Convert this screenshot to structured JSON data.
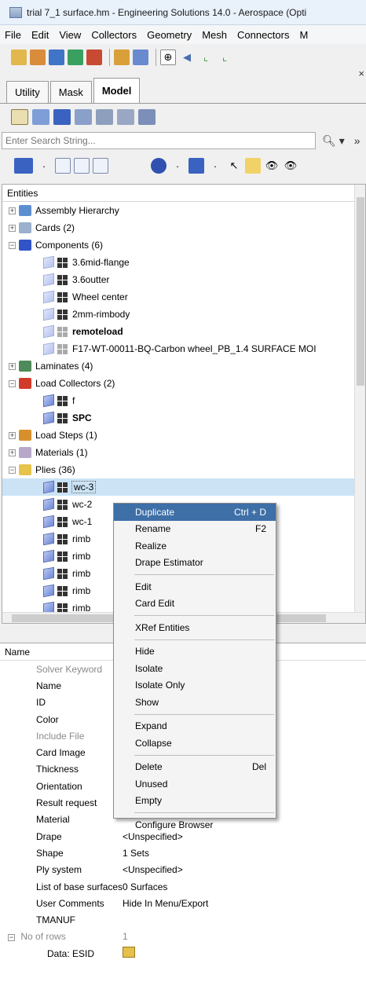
{
  "window": {
    "title": "trial 7_1 surface.hm - Engineering Solutions 14.0 - Aerospace (Opti"
  },
  "menu": [
    "File",
    "Edit",
    "View",
    "Collectors",
    "Geometry",
    "Mesh",
    "Connectors",
    "M"
  ],
  "tabs": [
    {
      "label": "Utility"
    },
    {
      "label": "Mask"
    },
    {
      "label": "Model"
    }
  ],
  "search": {
    "placeholder": "Enter Search String..."
  },
  "tree": {
    "header": "Entities",
    "rows": [
      {
        "label": "Assembly Hierarchy"
      },
      {
        "label": "Cards (2)"
      },
      {
        "label": "Components (6)"
      },
      {
        "label": "3.6mid-flange"
      },
      {
        "label": "3.6outter"
      },
      {
        "label": "Wheel center"
      },
      {
        "label": "2mm-rimbody"
      },
      {
        "label": "remoteload"
      },
      {
        "label": "F17-WT-00011-BQ-Carbon wheel_PB_1.4 SURFACE MOI"
      },
      {
        "label": "Laminates (4)"
      },
      {
        "label": "Load Collectors (2)"
      },
      {
        "label": "f"
      },
      {
        "label": "SPC"
      },
      {
        "label": "Load Steps (1)"
      },
      {
        "label": "Materials (1)"
      },
      {
        "label": "Plies (36)"
      },
      {
        "label": "wc-3"
      },
      {
        "label": "wc-2"
      },
      {
        "label": "wc-1"
      },
      {
        "label": "rimb"
      },
      {
        "label": "rimb"
      },
      {
        "label": "rimb"
      },
      {
        "label": "rimb"
      },
      {
        "label": "rimb"
      }
    ]
  },
  "properties": {
    "header": "Name",
    "rows": [
      {
        "name": "Solver Keyword",
        "value": ""
      },
      {
        "name": "Name",
        "value": ""
      },
      {
        "name": "ID",
        "value": ""
      },
      {
        "name": "Color",
        "value": ""
      },
      {
        "name": "Include File",
        "value": ""
      },
      {
        "name": "Card Image",
        "value": ""
      },
      {
        "name": "Thickness",
        "value": ""
      },
      {
        "name": "Orientation",
        "value": ""
      },
      {
        "name": "Result request",
        "value": ""
      },
      {
        "name": "Material",
        "value": ""
      },
      {
        "name": "Drape",
        "value": "<Unspecified>"
      },
      {
        "name": "Shape",
        "value": "1 Sets"
      },
      {
        "name": "Ply system",
        "value": "<Unspecified>"
      },
      {
        "name": "List of base surfaces",
        "value": "0 Surfaces"
      },
      {
        "name": "User Comments",
        "value": "Hide In Menu/Export"
      },
      {
        "name": "TMANUF",
        "value": ""
      },
      {
        "name": "No of rows",
        "value": "1"
      },
      {
        "name": "Data: ESID",
        "value": ""
      }
    ]
  },
  "context_menu": {
    "items": [
      {
        "label": "Duplicate",
        "shortcut": "Ctrl + D"
      },
      {
        "label": "Rename",
        "shortcut": "F2"
      },
      {
        "label": "Realize",
        "shortcut": ""
      },
      {
        "label": "Drape Estimator",
        "shortcut": ""
      },
      {
        "label": "Edit",
        "shortcut": ""
      },
      {
        "label": "Card Edit",
        "shortcut": ""
      },
      {
        "label": "XRef Entities",
        "shortcut": ""
      },
      {
        "label": "Hide",
        "shortcut": ""
      },
      {
        "label": "Isolate",
        "shortcut": ""
      },
      {
        "label": "Isolate Only",
        "shortcut": ""
      },
      {
        "label": "Show",
        "shortcut": ""
      },
      {
        "label": "Expand",
        "shortcut": ""
      },
      {
        "label": "Collapse",
        "shortcut": ""
      },
      {
        "label": "Delete",
        "shortcut": "Del"
      },
      {
        "label": "Unused",
        "shortcut": ""
      },
      {
        "label": "Empty",
        "shortcut": ""
      },
      {
        "label": "Configure Browser",
        "shortcut": ""
      }
    ]
  },
  "colors": {
    "selection": "#cbe3f5",
    "menu_highlight": "#3e6fa7"
  }
}
